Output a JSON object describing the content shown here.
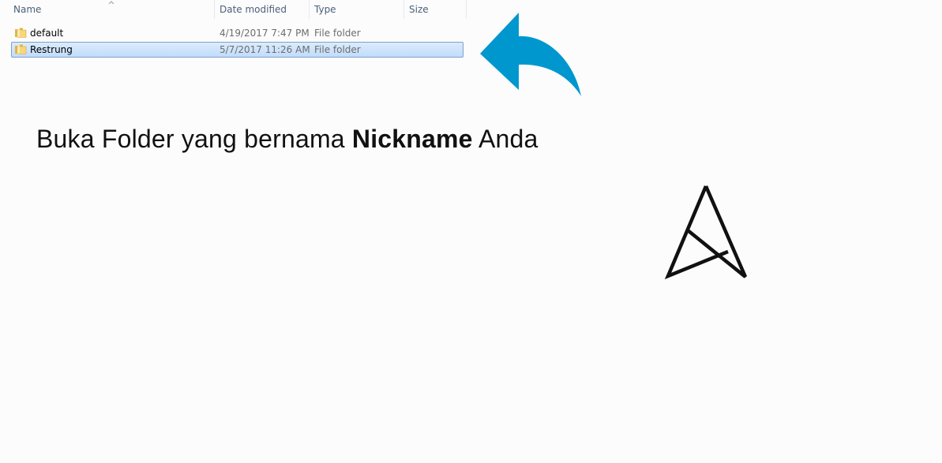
{
  "columns": {
    "name": "Name",
    "date_modified": "Date modified",
    "type": "Type",
    "size": "Size"
  },
  "files": [
    {
      "name": "default",
      "date_modified": "4/19/2017 7:47 PM",
      "type": "File folder",
      "selected": false,
      "icon": "folder-icon"
    },
    {
      "name": "Restrung",
      "date_modified": "5/7/2017 11:26 AM",
      "type": "File folder",
      "selected": true,
      "icon": "folder-icon"
    }
  ],
  "instruction": {
    "before": "Buka Folder yang bernama ",
    "bold": "Nickname",
    "after": " Anda"
  },
  "colors": {
    "arrow": "#0097cf",
    "selection": "#c9e0fc",
    "header_text": "#4c607a"
  },
  "icons": {
    "pointer": "curved-arrow-icon",
    "logo": "triangle-logo-icon",
    "sort": "sort-up-arrow-icon"
  }
}
